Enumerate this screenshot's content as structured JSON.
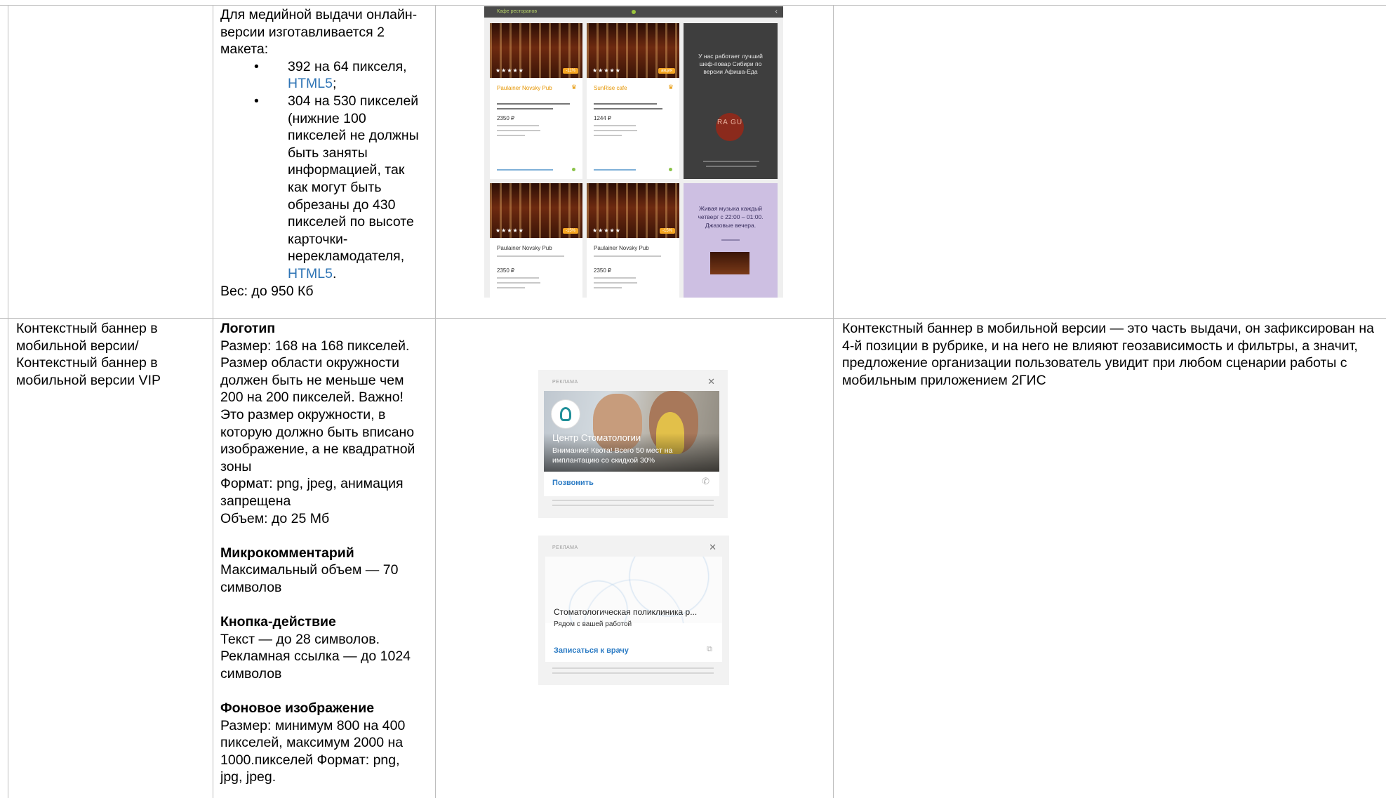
{
  "row1": {
    "specs_intro": "Для медийной выдачи онлайн-версии изготавливается 2 макета:",
    "bullets": [
      {
        "text": "392 на 64 пикселя, ",
        "link": "HTML5",
        "tail": ";"
      },
      {
        "text": "304 на 530 пикселей (нижние 100 пикселей не должны быть заняты информацией, так как могут быть обрезаны до 430 пикселей по высоте карточки-нерекламодателя, ",
        "link": "HTML5",
        "tail": "."
      }
    ],
    "weight": "Вес: до 950 Кб",
    "mockup": {
      "header": "Кафе ресторанов",
      "cards": [
        {
          "name": "Paulainer Novsky Pub",
          "price": "2350 ₽",
          "discount": "-11%"
        },
        {
          "name": "SunRise cafe",
          "price": "1244 ₽",
          "discount": "акция"
        },
        {
          "name": "Paulainer Novsky Pub",
          "price": "2350 ₽",
          "discount": "-15%"
        },
        {
          "name": "Paulainer Novsky Pub",
          "price": "2350 ₽",
          "discount": "-15%"
        }
      ],
      "dark_ad_text": "У нас работает лучший шеф-повар Сибири по версии Афиша-Еда",
      "ragu_logo": "RA GU",
      "lilac_ad_text": "Живая музыка каждый четверг с 22:00 – 01:00. Джазовые вечера."
    }
  },
  "row2": {
    "title": "Контекстный баннер в мобильной версии/ Контекстный баннер в мобильной версии VIP",
    "sections": [
      {
        "heading": "Логотип",
        "body": "Размер: 168 на 168 пикселей. Размер области окружности должен быть не меньше чем 200 на 200 пикселей. Важно! Это размер окружности, в которую должно быть вписано изображение, а не квадратной зоны"
      },
      {
        "heading": "",
        "body": "Формат: png, jpeg, анимация запрещена"
      },
      {
        "heading": "",
        "body": "Объем: до 25 Мб"
      },
      {
        "heading": "Микрокомментарий",
        "body": "Максимальный объем — 70 символов"
      },
      {
        "heading": "Кнопка-действие",
        "body": "Текст — до 28 символов. Рекламная ссылка — до 1024 символов"
      },
      {
        "heading": "Фоновое изображение",
        "body": "Размер: минимум 800 на 400 пикселей, максимум 2000 на 1000.пикселей Формат: png, jpg, jpeg."
      }
    ],
    "description": "Контекстный баннер в мобильной версии — это часть выдачи, он зафиксирован на 4-й позиции в рубрике, и на него не влияют геозависимость и фильтры, а значит, предложение организации пользователь увидит при любом сценарии работы с мобильным приложением 2ГИС",
    "banner1": {
      "label": "РЕКЛАМА",
      "title": "Центр Стоматологии",
      "text": "Внимание! Квота! Всего 50 мест на имплантацию со скидкой 30%",
      "cta": "Позвонить"
    },
    "banner2": {
      "label": "РЕКЛАМА",
      "title": "Стоматологическая поликлиника р...",
      "sub": "Рядом с вашей работой",
      "cta": "Записаться к врачу"
    }
  }
}
